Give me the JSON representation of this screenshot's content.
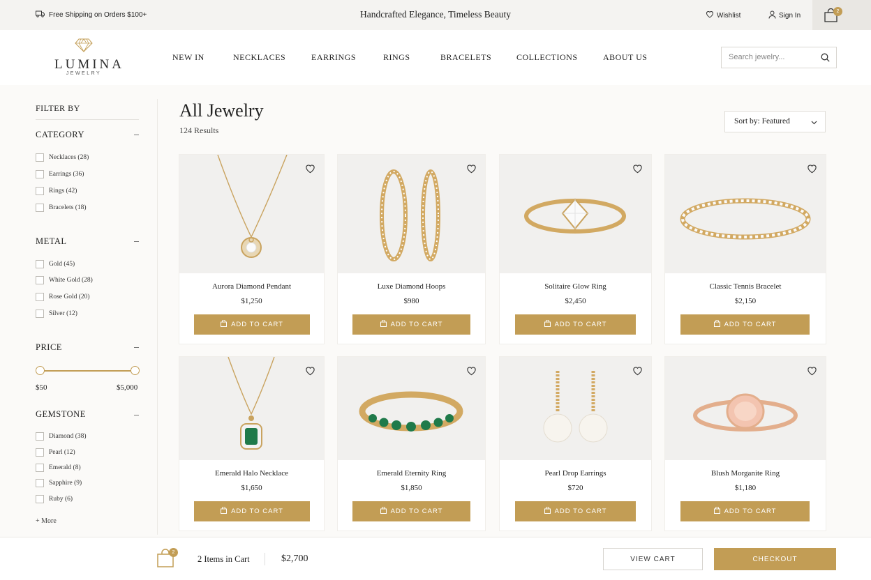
{
  "topbar": {
    "shipping": "Free Shipping on Orders $100+",
    "tagline": "Handcrafted Elegance, Timeless Beauty",
    "wishlist": "Wishlist",
    "signin": "Sign In",
    "cart_count": "2"
  },
  "brand": {
    "name": "LUMINA",
    "sub": "JEWELRY"
  },
  "nav": [
    "NEW IN",
    "NECKLACES",
    "EARRINGS",
    "RINGS",
    "BRACELETS",
    "COLLECTIONS",
    "ABOUT US"
  ],
  "search": {
    "placeholder": "Search jewelry..."
  },
  "filters": {
    "heading": "FILTER BY",
    "category": {
      "title": "CATEGORY",
      "options": [
        "Necklaces (28)",
        "Earrings (36)",
        "Rings (42)",
        "Bracelets (18)"
      ]
    },
    "metal": {
      "title": "METAL",
      "options": [
        "Gold (45)",
        "White Gold (28)",
        "Rose Gold (20)",
        "Silver (12)"
      ]
    },
    "price": {
      "title": "PRICE",
      "min_label": "$50",
      "max_label": "$5,000"
    },
    "gemstone": {
      "title": "GEMSTONE",
      "options": [
        "Diamond (38)",
        "Pearl (12)",
        "Emerald (8)",
        "Sapphire (9)",
        "Ruby (6)"
      ]
    },
    "more": "+ More"
  },
  "listing": {
    "title": "All Jewelry",
    "results": "124 Results",
    "sort": "Sort by: Featured"
  },
  "add_to_cart_label": "ADD TO CART",
  "products": [
    {
      "name": "Aurora Diamond Pendant",
      "price": "$1,250"
    },
    {
      "name": "Luxe Diamond Hoops",
      "price": "$980"
    },
    {
      "name": "Solitaire Glow Ring",
      "price": "$2,450"
    },
    {
      "name": "Classic Tennis Bracelet",
      "price": "$2,150"
    },
    {
      "name": "Emerald Halo Necklace",
      "price": "$1,650"
    },
    {
      "name": "Emerald Eternity Ring",
      "price": "$1,850"
    },
    {
      "name": "Pearl Drop Earrings",
      "price": "$720"
    },
    {
      "name": "Blush Morganite Ring",
      "price": "$1,180"
    }
  ],
  "cartbar": {
    "count_badge": "2",
    "items": "2 Items in Cart",
    "total": "$2,700",
    "view_cart": "VIEW CART",
    "checkout": "CHECKOUT"
  },
  "colors": {
    "accent": "#c29d55",
    "topbar_bg": "#f4f3f1",
    "image_bg": "#f1f0ee"
  }
}
